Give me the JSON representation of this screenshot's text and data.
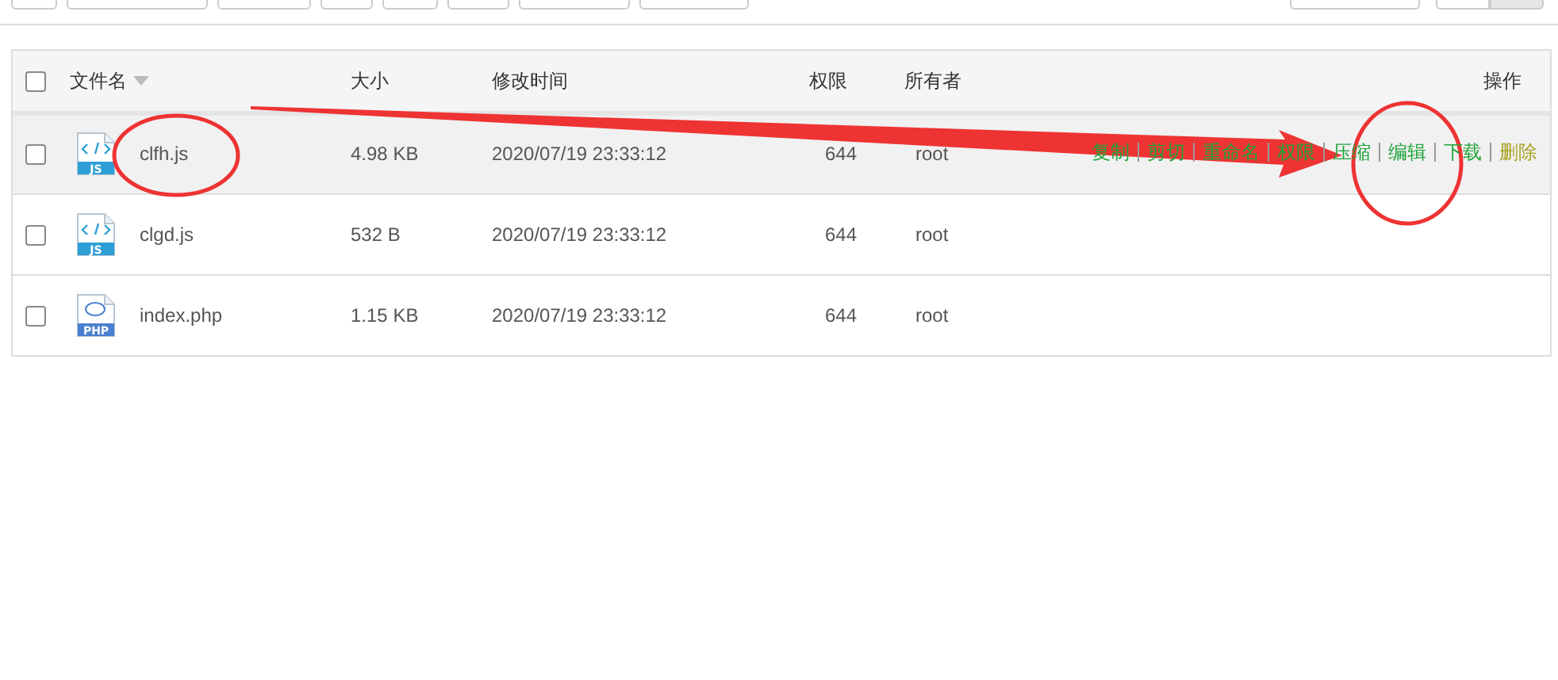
{
  "toolbar": {
    "right_controls": {
      "toggle": [
        {
          "selected": false
        },
        {
          "selected": true
        }
      ]
    }
  },
  "table": {
    "columns": [
      {
        "label": "文件名",
        "sortable": true
      },
      {
        "label": "大小"
      },
      {
        "label": "修改时间"
      },
      {
        "label": "权限"
      },
      {
        "label": "所有者"
      },
      {
        "label": "操作"
      }
    ],
    "header_checked": false,
    "rows": [
      {
        "checked": false,
        "highlighted": true,
        "icon": {
          "kind": "code",
          "label": "JS"
        },
        "name": "clfh.js",
        "size": "4.98 KB",
        "modified": "2020/07/19 23:33:12",
        "permissions": "644",
        "owner": "root",
        "actions": [
          {
            "label": "复制",
            "kind": "normal"
          },
          {
            "label": "剪切",
            "kind": "normal"
          },
          {
            "label": "重命名",
            "kind": "normal"
          },
          {
            "label": "权限",
            "kind": "normal"
          },
          {
            "label": "压缩",
            "kind": "normal"
          },
          {
            "label": "编辑",
            "kind": "normal"
          },
          {
            "label": "下载",
            "kind": "normal"
          },
          {
            "label": "删除",
            "kind": "danger"
          }
        ]
      },
      {
        "checked": false,
        "highlighted": false,
        "icon": {
          "kind": "code",
          "label": "JS"
        },
        "name": "clgd.js",
        "size": "532 B",
        "modified": "2020/07/19 23:33:12",
        "permissions": "644",
        "owner": "root"
      },
      {
        "checked": false,
        "highlighted": false,
        "icon": {
          "kind": "php",
          "label": "PHP"
        },
        "name": "index.php",
        "size": "1.15 KB",
        "modified": "2020/07/19 23:33:12",
        "permissions": "644",
        "owner": "root"
      }
    ]
  }
}
